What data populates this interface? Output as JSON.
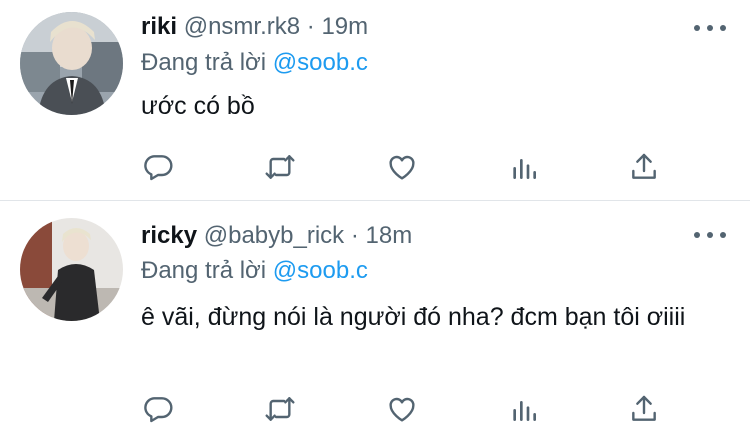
{
  "tweets": [
    {
      "name": "riki",
      "handle": "@nsmr.rk8",
      "separator": "·",
      "time": "19m",
      "replying_prefix": "Đang trả lời",
      "replying_to": "@soob.c",
      "text": "ước có bồ",
      "avatar_icon": "profile-photo"
    },
    {
      "name": "ricky",
      "handle": "@babyb_rick",
      "separator": "·",
      "time": "18m",
      "replying_prefix": "Đang trả lời",
      "replying_to": "@soob.c",
      "text": "ê vãi, đừng nói là người đó nha? đcm bạn tôi ơiiii",
      "avatar_icon": "profile-photo"
    }
  ],
  "actions": [
    "reply-icon",
    "retweet-icon",
    "like-icon",
    "analytics-icon",
    "share-icon"
  ],
  "colors": {
    "text": "#0f1419",
    "secondary": "#536471",
    "link": "#1d9bf0",
    "divider": "#e1e5e9",
    "icon": "#536471"
  }
}
